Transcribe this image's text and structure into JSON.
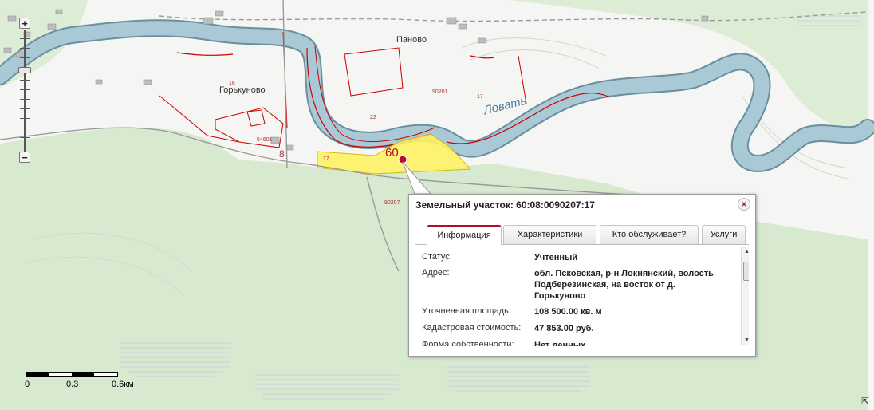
{
  "map": {
    "places": {
      "gorkunovo": "Горькуново",
      "panovo": "Паново",
      "river": "Ловать"
    },
    "parcel_numbers": {
      "p16": "16",
      "p54601": "54601",
      "p8": "8",
      "p90201": "90201",
      "p22": "22",
      "p17a": "17",
      "p17b": "17",
      "p90207": "90207",
      "big60": "60"
    },
    "colors": {
      "river_fill": "#a9c9d6",
      "river_edge": "#6a8f9f",
      "forest": "#cfe6c5",
      "parcel_highlight": "#fff266",
      "boundary_red": "#cc0000"
    }
  },
  "zoom": {
    "plus": "+",
    "minus": "−"
  },
  "scale": {
    "labels": [
      "0",
      "0.3",
      "0.6км"
    ]
  },
  "popup": {
    "title": "Земельный участок: 60:08:0090207:17",
    "close_symbol": "×",
    "tabs": [
      {
        "label": "Информация",
        "active": true
      },
      {
        "label": "Характеристики",
        "active": false
      },
      {
        "label": "Кто обслуживает?",
        "active": false
      },
      {
        "label": "Услуги",
        "active": false
      }
    ],
    "rows": [
      {
        "label": "Статус:",
        "value": "Учтенный"
      },
      {
        "label": "Адрес:",
        "value": "обл. Псковская, р-н Локнянский, волость Подберезинская, на восток от д. Горькуново"
      },
      {
        "label": "Уточненная площадь:",
        "value": "108 500.00 кв. м"
      },
      {
        "label": "Кадастровая стоимость:",
        "value": "47 853.00 руб."
      },
      {
        "label": "Форма собственности:",
        "value": "Нет данных"
      }
    ]
  },
  "icons": {
    "resize": "⇱"
  }
}
